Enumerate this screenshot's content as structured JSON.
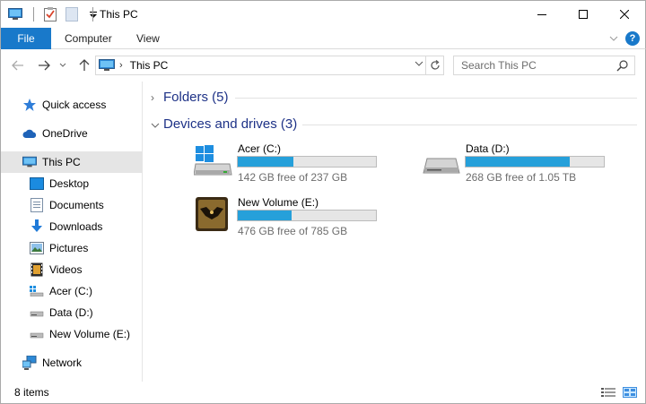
{
  "window": {
    "title": "This PC",
    "minimize_icon": "minimize-icon",
    "maximize_icon": "maximize-icon",
    "close_icon": "close-icon"
  },
  "ribbon": {
    "tabs": [
      {
        "label": "File",
        "active": true
      },
      {
        "label": "Computer"
      },
      {
        "label": "View"
      }
    ],
    "help_label": "?"
  },
  "address": {
    "path": "This PC",
    "search_placeholder": "Search This PC"
  },
  "sidebar": {
    "items": [
      {
        "label": "Quick access",
        "icon": "star-icon"
      },
      {
        "label": "OneDrive",
        "icon": "cloud-icon"
      },
      {
        "label": "This PC",
        "icon": "computer-icon",
        "selected": true
      },
      {
        "label": "Desktop",
        "icon": "desktop-icon"
      },
      {
        "label": "Documents",
        "icon": "documents-icon"
      },
      {
        "label": "Downloads",
        "icon": "download-icon"
      },
      {
        "label": "Pictures",
        "icon": "pictures-icon"
      },
      {
        "label": "Videos",
        "icon": "videos-icon"
      },
      {
        "label": "Acer (C:)",
        "icon": "drive-icon"
      },
      {
        "label": "Data (D:)",
        "icon": "drive-icon"
      },
      {
        "label": "New Volume (E:)",
        "icon": "drive-icon"
      },
      {
        "label": "Network",
        "icon": "network-icon"
      }
    ]
  },
  "groups": {
    "folders": "Folders (5)",
    "devices": "Devices and drives (3)"
  },
  "drives": [
    {
      "name": "Acer (C:)",
      "free": "142 GB free of 237 GB",
      "used_fraction": 0.4
    },
    {
      "name": "Data (D:)",
      "free": "268 GB free of 1.05 TB",
      "used_fraction": 0.75
    },
    {
      "name": "New Volume (E:)",
      "free": "476 GB free of 785 GB",
      "used_fraction": 0.39
    }
  ],
  "status": {
    "items_count": "8 items"
  },
  "colors": {
    "accent": "#1979ca",
    "bar_fill": "#26a0da",
    "group_text": "#1e3287"
  }
}
